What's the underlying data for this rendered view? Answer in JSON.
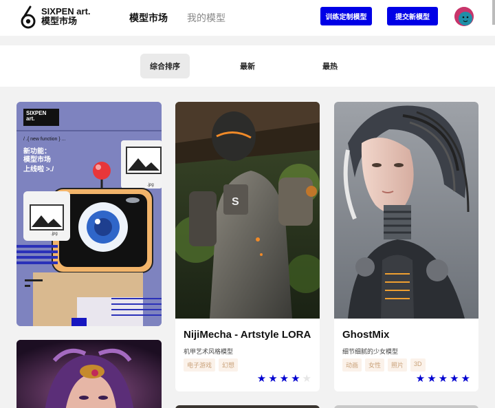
{
  "header": {
    "brand_line1": "SIXPEN art.",
    "brand_line2": "模型市场",
    "nav_market": "模型市场",
    "nav_mine": "我的模型",
    "btn_train": "训练定制模型",
    "btn_submit": "提交新模型"
  },
  "sort": {
    "composite": "综合排序",
    "newest": "最新",
    "hottest": "最热"
  },
  "promo": {
    "brand": "SIXPEN",
    "brand2": "art.",
    "code": "/ .{ new function } ...",
    "line1": "新功能：",
    "line2": "模型市场",
    "line3": "上线啦 >./",
    "jpg": ".jpg"
  },
  "cards": [
    {
      "title": "NijiMecha - Artstyle LORA",
      "desc": "机甲艺术风格模型",
      "tags": [
        "电子游戏",
        "幻想"
      ],
      "rating": 4
    },
    {
      "title": "GhostMix",
      "desc": "细节细腻的少女模型",
      "tags": [
        "动画",
        "女性",
        "照片",
        "3D"
      ],
      "rating": 5
    }
  ],
  "colors": {
    "accent": "#0000e6",
    "promo_bg": "#7e83bf",
    "tag_text": "#c9a27a",
    "tag_bg": "#fbf2ea"
  }
}
